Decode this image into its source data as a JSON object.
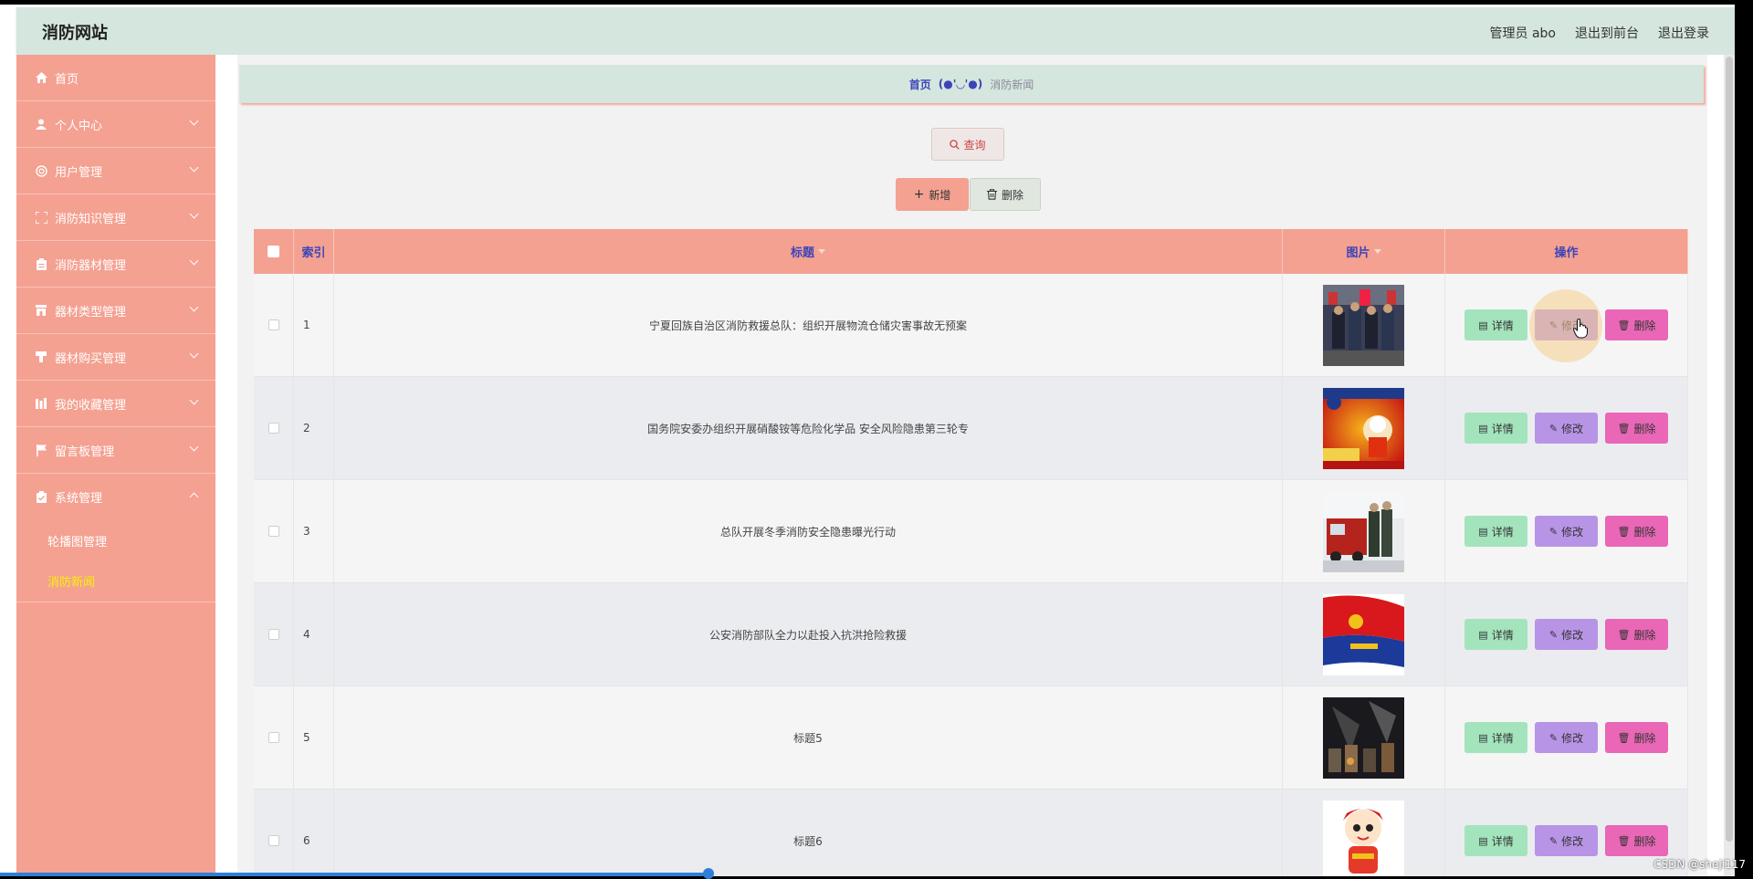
{
  "header": {
    "site_title": "消防网站",
    "admin_label": "管理员 abo",
    "to_front": "退出到前台",
    "logout": "退出登录"
  },
  "sidebar": {
    "items": [
      {
        "label": "首页",
        "icon": "home-icon"
      },
      {
        "label": "个人中心",
        "icon": "user-icon"
      },
      {
        "label": "用户管理",
        "icon": "users-icon"
      },
      {
        "label": "消防知识管理",
        "icon": "fullscreen-icon"
      },
      {
        "label": "消防器材管理",
        "icon": "clipboard-icon"
      },
      {
        "label": "器材类型管理",
        "icon": "shop-icon"
      },
      {
        "label": "器材购买管理",
        "icon": "goods-icon"
      },
      {
        "label": "我的收藏管理",
        "icon": "collection-icon"
      },
      {
        "label": "留言板管理",
        "icon": "flag-icon"
      },
      {
        "label": "系统管理",
        "icon": "system-icon"
      }
    ],
    "sub_items": [
      {
        "label": "轮播图管理"
      },
      {
        "label": "消防新闻"
      }
    ]
  },
  "breadcrumb": {
    "home": "首页",
    "face": "(●'◡'●)",
    "current": "消防新闻"
  },
  "actions": {
    "query": "查询",
    "add": "新增",
    "delete": "删除"
  },
  "table": {
    "headers": {
      "index": "索引",
      "title": "标题",
      "image": "图片",
      "ops": "操作"
    },
    "op_labels": {
      "detail": "详情",
      "edit": "修改",
      "remove": "删除"
    },
    "rows": [
      {
        "index": "1",
        "title": "宁夏回族自治区消防救援总队：组织开展物流仓储灾害事故无预案"
      },
      {
        "index": "2",
        "title": "国务院安委办组织开展硝酸铵等危险化学品 安全风险隐患第三轮专"
      },
      {
        "index": "3",
        "title": "总队开展冬季消防安全隐患曝光行动"
      },
      {
        "index": "4",
        "title": "公安消防部队全力以赴投入抗洪抢险救援"
      },
      {
        "index": "5",
        "title": "标题5"
      },
      {
        "index": "6",
        "title": "标题6"
      }
    ]
  },
  "watermark": "CSDN @sheji117",
  "colors": {
    "header_bg": "#d4e6de",
    "sidebar_bg": "#f4a191",
    "accent_text": "#3d44b8",
    "active_sub": "#f8f200",
    "detail_btn": "#a3e4bd",
    "edit_btn": "#b894e6",
    "remove_btn": "#e967b6"
  }
}
